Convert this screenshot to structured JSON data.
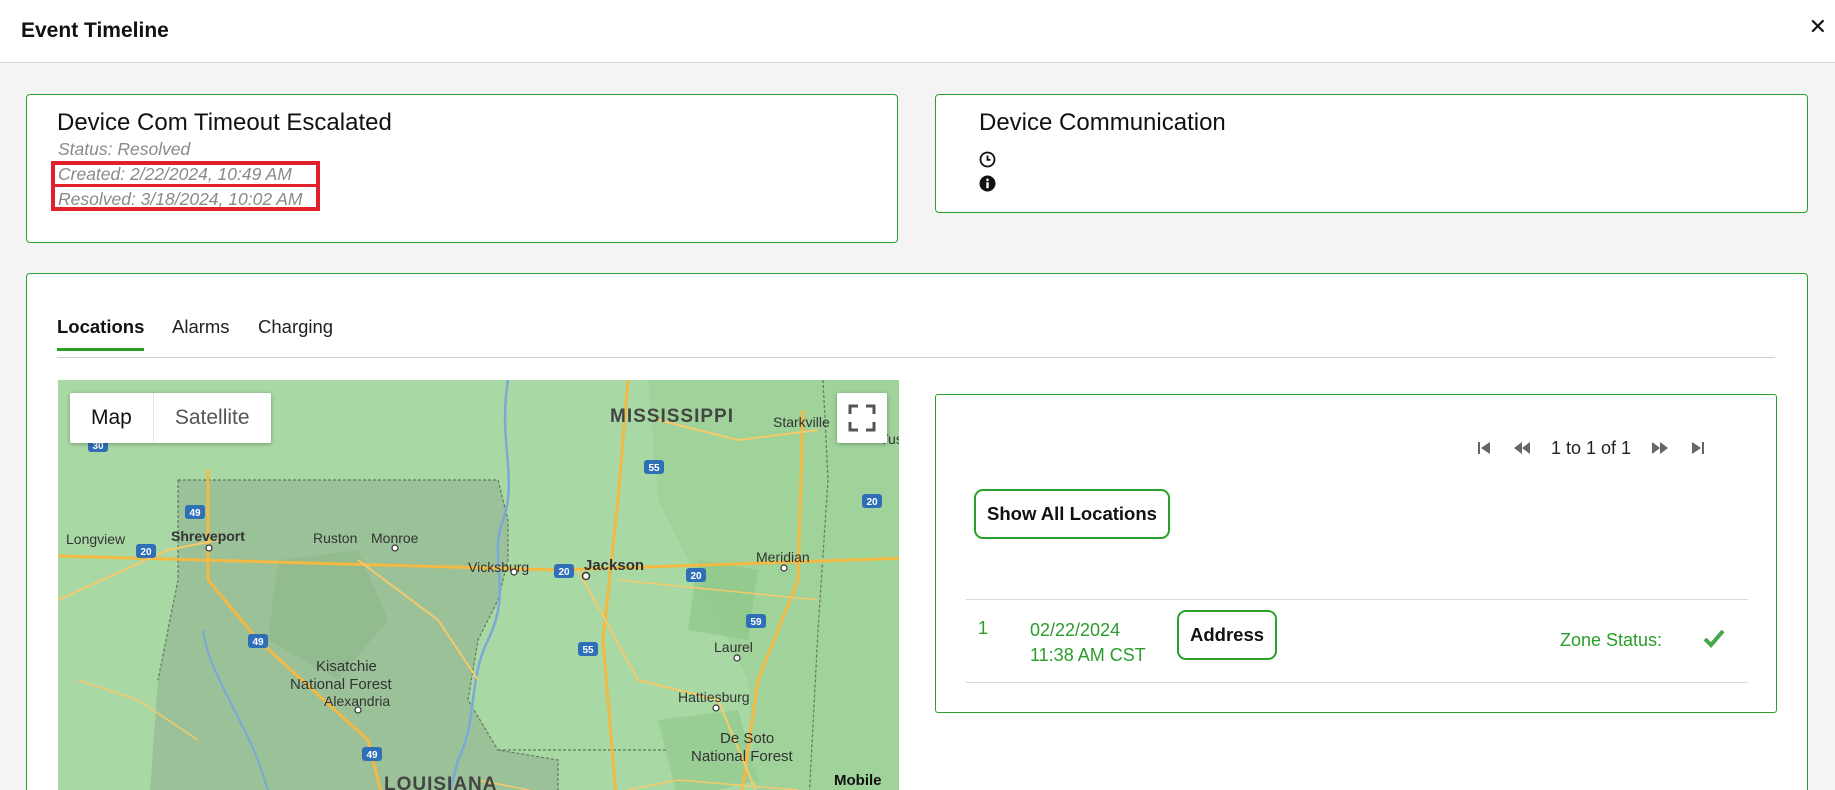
{
  "header": {
    "title": "Event Timeline",
    "close_icon": "close-icon"
  },
  "event": {
    "title": "Device Com Timeout Escalated",
    "status": "Status: Resolved",
    "created": "Created: 2/22/2024, 10:49 AM",
    "resolved": "Resolved: 3/18/2024, 10:02 AM"
  },
  "communication": {
    "title": "Device Communication",
    "icons": [
      "clock-icon",
      "info-icon"
    ]
  },
  "tabs": [
    {
      "label": "Locations",
      "active": true
    },
    {
      "label": "Alarms",
      "active": false
    },
    {
      "label": "Charging",
      "active": false
    }
  ],
  "map": {
    "type_options": [
      {
        "label": "Map",
        "active": true
      },
      {
        "label": "Satellite",
        "active": false
      }
    ],
    "labels": {
      "mississippi": "MISSISSIPPI",
      "louisiana": "LOUISIANA",
      "starkville": "Starkville",
      "tus": "Tus",
      "longview": "Longview",
      "shreveport": "Shreveport",
      "ruston": "Ruston",
      "monroe": "Monroe",
      "vicksburg": "Vicksburg",
      "jackson": "Jackson",
      "meridian": "Meridian",
      "laurel": "Laurel",
      "kisatchie": "Kisatchie",
      "national_forest": "National Forest",
      "alexandria": "Alexandria",
      "hattiesburg": "Hattiesburg",
      "de_soto": "De Soto",
      "de_soto_forest": "National Forest",
      "mobile": "Mobile"
    },
    "shields": {
      "i30": "30",
      "i49a": "49",
      "i20a": "20",
      "i55a": "55",
      "i20b": "20",
      "i20c": "20",
      "i20d": "20",
      "i59": "59",
      "i55b": "55",
      "i49b": "49",
      "i49c": "49"
    }
  },
  "pager": {
    "text": "1 to 1 of 1"
  },
  "show_all_label": "Show All Locations",
  "locations": [
    {
      "index": "1",
      "date": "02/22/2024",
      "time": "11:38 AM CST",
      "address_label": "Address",
      "zone_label": "Zone Status:"
    }
  ],
  "colors": {
    "accent": "#2aa02a",
    "highlight": "#e0202a",
    "map_land": "#a8d8a4"
  }
}
